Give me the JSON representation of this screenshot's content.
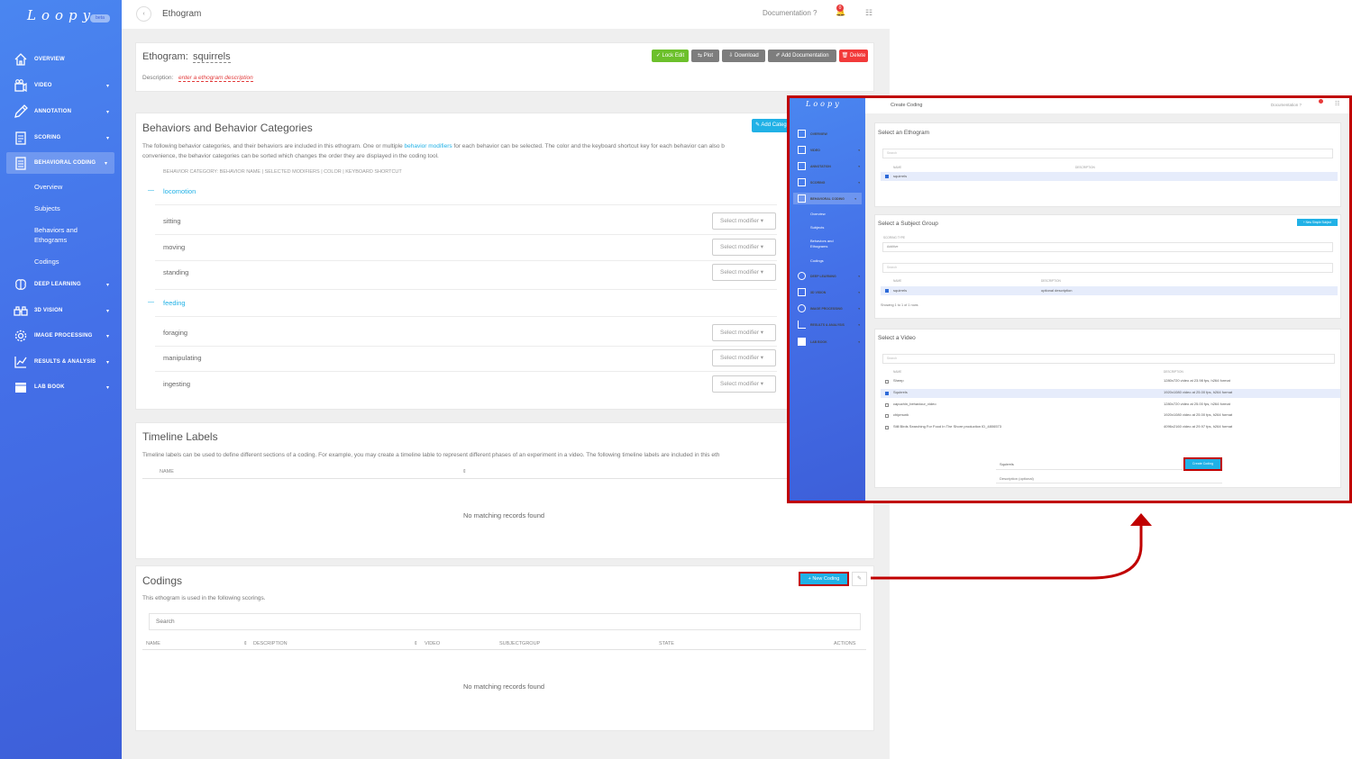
{
  "sidebar": {
    "logo": "Loopy",
    "badge": "beta",
    "items": [
      {
        "label": "OVERVIEW",
        "icon": "home-icon"
      },
      {
        "label": "VIDEO",
        "icon": "video-icon"
      },
      {
        "label": "ANNOTATION",
        "icon": "pencil-icon"
      },
      {
        "label": "SCORING",
        "icon": "clipboard-icon"
      },
      {
        "label": "BEHAVIORAL CODING",
        "icon": "coding-icon"
      },
      {
        "label": "DEEP LEARNING",
        "icon": "brain-icon"
      },
      {
        "label": "3D VISION",
        "icon": "binoculars-icon"
      },
      {
        "label": "IMAGE PROCESSING",
        "icon": "gear-icon"
      },
      {
        "label": "RESULTS & ANALYSIS",
        "icon": "chart-icon"
      },
      {
        "label": "LAB BOOK",
        "icon": "book-icon"
      }
    ],
    "sub_items": [
      "Overview",
      "Subjects",
      "Behaviors and Ethograms",
      "Codings"
    ]
  },
  "topbar": {
    "page_title": "Ethogram",
    "documentation": "Documentation ?",
    "notif_count": "0"
  },
  "ethogram": {
    "title_label": "Ethogram:",
    "name": "squirrels",
    "desc_label": "Description:",
    "desc_placeholder": "enter a ethogram description",
    "buttons": {
      "lock": "✓ Lock Edit",
      "plot": "⇆ Plot",
      "download": "⇩ Download",
      "add_doc": "✐ Add Documentation",
      "delete": "🗑 Delete"
    }
  },
  "behaviors": {
    "title": "Behaviors and Behavior Categories",
    "add_button": "✎ Add Categ",
    "text1_a": "The following behavior categories, and their behaviors are included in this ethogram. One or multiple ",
    "text1_link": "behavior modifiers",
    "text1_b": " for each behavior can be selected. The color and the keyboard shortcut key for each behavior can also b",
    "text2": "convenience, the behavior categories can be sorted which changes the order they are displayed in the coding tool.",
    "header": "BEHAVIOR CATEGORY: BEHAVIOR NAME | SELECTED MODIFIERS | COLOR | KEYBOARD SHORTCUT",
    "select_modifier": "Select modifier ▾",
    "toggle": "—",
    "categories": [
      {
        "name": "locomotion",
        "behaviors": [
          "sitting",
          "moving",
          "standing"
        ]
      },
      {
        "name": "feeding",
        "behaviors": [
          "foraging",
          "manipulating",
          "ingesting"
        ]
      }
    ]
  },
  "timeline": {
    "title": "Timeline Labels",
    "text": "Timeline labels can be used to define different sections of a coding. For example, you may create a timeline lable to represent different phases of an experiment in a video. The following timeline labels are included in this eth",
    "col_name": "NAME",
    "sort": "⇕",
    "empty": "No matching records found"
  },
  "codings": {
    "title": "Codings",
    "new_button": "+ New Coding",
    "extra_button": "✎",
    "text": "This ethogram is used in the following scorings.",
    "search_placeholder": "Search",
    "columns": [
      "NAME",
      "DESCRIPTION",
      "VIDEO",
      "SUBJECTGROUP",
      "STATE",
      "ACTIONS"
    ],
    "sort": "⇕",
    "empty": "No matching records found"
  },
  "inset": {
    "logo": "Loopy",
    "nav": [
      "OVERVIEW",
      "VIDEO",
      "ANNOTATION",
      "SCORING",
      "BEHAVIORAL CODING",
      "DEEP LEARNING",
      "3D VISION",
      "IMAGE PROCESSING",
      "RESULTS & ANALYSIS",
      "LAB BOOK"
    ],
    "sub": [
      "Overview",
      "Subjects",
      "Behaviors and Ethograms",
      "Codings"
    ],
    "topbar": {
      "title": "Create Coding",
      "documentation": "Documentation ?"
    },
    "ethogram": {
      "title": "Select an Ethogram",
      "search": "Search",
      "col_name": "NAME",
      "col_desc": "DESCRIPTION",
      "rows": [
        {
          "name": "squirrels",
          "desc": ""
        }
      ]
    },
    "subject": {
      "title": "Select a Subject Group",
      "new_button": "+ New Simple Subject",
      "scoring_type_label": "SCORING TYPE",
      "scoring_type": "Additive",
      "search": "Search",
      "col_name": "NAME",
      "col_desc": "DESCRIPTION",
      "rows": [
        {
          "name": "squirrels",
          "desc": "optional description"
        }
      ],
      "showing": "Showing 1 to 1 of 1 rows"
    },
    "video": {
      "title": "Select a Video",
      "search": "Search",
      "col_name": "NAME",
      "col_desc": "DESCRIPTION",
      "rows": [
        {
          "name": "Sheep",
          "desc": "1280x720 video at 23.98 fps, h264 format",
          "checked": false
        },
        {
          "name": "Squirrels",
          "desc": "1920x1080 video at 25.00 fps, h264 format",
          "checked": true
        },
        {
          "name": "capuchin_behaviour_video",
          "desc": "1280x720 video at 25.00 fps, h264 format",
          "checked": false
        },
        {
          "name": "chipmunk",
          "desc": "1920x1080 video at 25.00 fps, h264 format",
          "checked": false
        },
        {
          "name": "Still Birds Searching For Food In The Shore production ID_4806573",
          "desc": "4096x2160 video at 29.97 fps, h264 format",
          "checked": false
        }
      ]
    },
    "form": {
      "name_value": "Squirrels",
      "desc_placeholder": "Description (optional)",
      "create_button": "Create Coding"
    }
  },
  "colors": {
    "accent": "#21b1e6",
    "highlight_border": "#c00000",
    "green": "#6cc02b",
    "grey": "#7d7d7d",
    "red": "#f23a3a"
  }
}
